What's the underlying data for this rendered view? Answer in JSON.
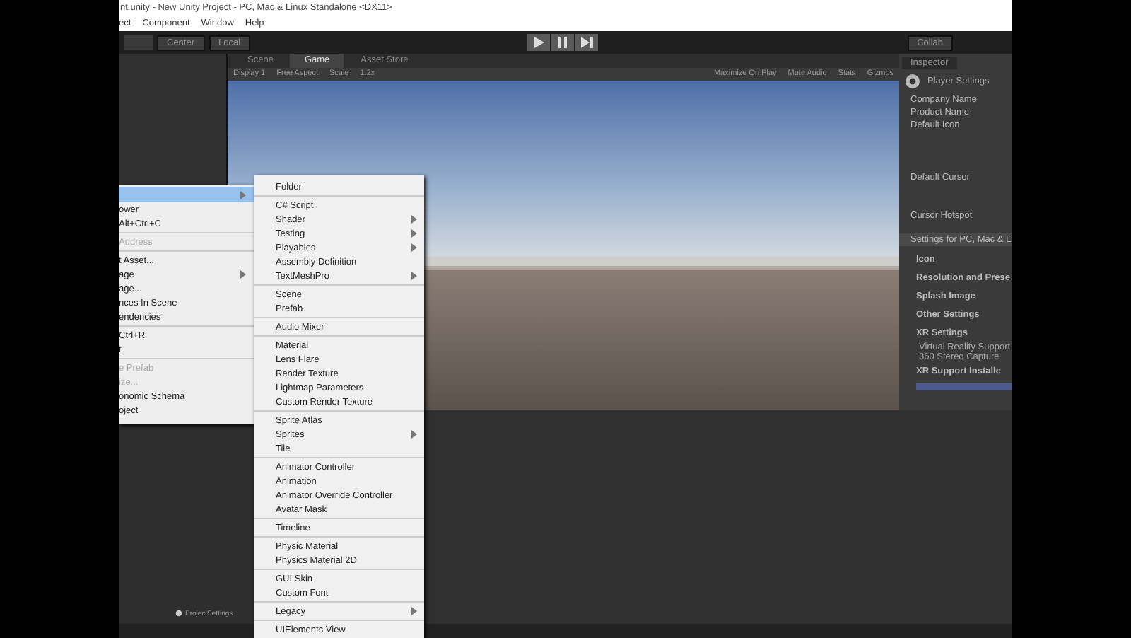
{
  "window": {
    "title": "nt.unity - New Unity Project - PC, Mac & Linux Standalone <DX11>"
  },
  "menu_bar": [
    "ect",
    "Component",
    "Window",
    "Help"
  ],
  "toolbar": {
    "pivot_buttons": [
      "Center",
      "Local"
    ],
    "collab": "Collab"
  },
  "view_tabs": [
    {
      "label": "Scene",
      "selected": false
    },
    {
      "label": "Game",
      "selected": true
    },
    {
      "label": "Asset Store",
      "selected": false
    }
  ],
  "game_bar": {
    "display": "Display 1",
    "aspect": "Free Aspect",
    "scale_label": "Scale",
    "scale_value": "1.2x",
    "toggles": [
      "Maximize On Play",
      "Mute Audio",
      "Stats",
      "Gizmos"
    ]
  },
  "context_menu": {
    "groups": [
      [
        {
          "selected": true,
          "disabled": false,
          "submenu": true
        },
        {
          "label": "ower",
          "selected": false,
          "disabled": false,
          "submenu": false
        },
        {
          "shortcut": "Alt+Ctrl+C",
          "selected": false,
          "disabled": false,
          "submenu": false
        }
      ],
      [
        {
          "label": "Address",
          "selected": false,
          "disabled": true,
          "submenu": false
        }
      ],
      [
        {
          "label": "t Asset...",
          "selected": false,
          "disabled": false,
          "submenu": false
        },
        {
          "label": "age",
          "selected": false,
          "disabled": false,
          "submenu": true
        },
        {
          "label": "age...",
          "selected": false,
          "disabled": false,
          "submenu": false
        },
        {
          "label": "nces In Scene",
          "selected": false,
          "disabled": false,
          "submenu": false
        },
        {
          "label": "endencies",
          "selected": false,
          "disabled": false,
          "submenu": false
        }
      ],
      [
        {
          "shortcut": "Ctrl+R",
          "selected": false,
          "disabled": false,
          "submenu": false
        },
        {
          "label": "t",
          "selected": false,
          "disabled": false,
          "submenu": false
        }
      ],
      [
        {
          "label": "e Prefab",
          "selected": false,
          "disabled": true,
          "submenu": false
        },
        {
          "label": "ize...",
          "selected": false,
          "disabled": true,
          "submenu": false
        },
        {
          "label": "onomic Schema",
          "selected": false,
          "disabled": false,
          "submenu": false
        },
        {
          "label": "oject",
          "selected": false,
          "disabled": false,
          "submenu": false
        }
      ]
    ]
  },
  "create_submenu": {
    "groups": [
      [
        {
          "label": "Folder",
          "submenu": false
        }
      ],
      [
        {
          "label": "C# Script",
          "submenu": false
        },
        {
          "label": "Shader",
          "submenu": true
        },
        {
          "label": "Testing",
          "submenu": true
        },
        {
          "label": "Playables",
          "submenu": true
        },
        {
          "label": "Assembly Definition",
          "submenu": false
        },
        {
          "label": "TextMeshPro",
          "submenu": true
        }
      ],
      [
        {
          "label": "Scene",
          "submenu": false
        },
        {
          "label": "Prefab",
          "submenu": false
        }
      ],
      [
        {
          "label": "Audio Mixer",
          "submenu": false
        }
      ],
      [
        {
          "label": "Material",
          "submenu": false
        },
        {
          "label": "Lens Flare",
          "submenu": false
        },
        {
          "label": "Render Texture",
          "submenu": false
        },
        {
          "label": "Lightmap Parameters",
          "submenu": false
        },
        {
          "label": "Custom Render Texture",
          "submenu": false
        }
      ],
      [
        {
          "label": "Sprite Atlas",
          "submenu": false
        },
        {
          "label": "Sprites",
          "submenu": true
        },
        {
          "label": "Tile",
          "submenu": false
        }
      ],
      [
        {
          "label": "Animator Controller",
          "submenu": false
        },
        {
          "label": "Animation",
          "submenu": false
        },
        {
          "label": "Animator Override Controller",
          "submenu": false
        },
        {
          "label": "Avatar Mask",
          "submenu": false
        }
      ],
      [
        {
          "label": "Timeline",
          "submenu": false
        }
      ],
      [
        {
          "label": "Physic Material",
          "submenu": false
        },
        {
          "label": "Physics Material 2D",
          "submenu": false
        }
      ],
      [
        {
          "label": "GUI Skin",
          "submenu": false
        },
        {
          "label": "Custom Font",
          "submenu": false
        }
      ],
      [
        {
          "label": "Legacy",
          "submenu": true
        }
      ],
      [
        {
          "label": "UIElements View",
          "submenu": false
        }
      ]
    ]
  },
  "project_panel": {
    "folder": "ProjectSettings"
  },
  "inspector": {
    "tab": "Inspector",
    "title": "Player Settings",
    "fields": [
      "Company Name",
      "Product Name",
      "Default Icon",
      "Default Cursor",
      "Cursor Hotspot"
    ],
    "platform": "Settings for PC, Mac & Li",
    "sections": [
      {
        "label": "Icon",
        "kind": "foldout"
      },
      {
        "label": "Resolution and Prese",
        "kind": "foldout"
      },
      {
        "label": "Splash Image",
        "kind": "foldout"
      },
      {
        "label": "Other Settings",
        "kind": "foldout"
      },
      {
        "label": "XR Settings",
        "kind": "foldout"
      },
      {
        "label": "Virtual Reality Support",
        "kind": "row"
      },
      {
        "label": "360 Stereo Capture",
        "kind": "row"
      },
      {
        "label": "XR Support Installe",
        "kind": "foldout"
      }
    ]
  }
}
